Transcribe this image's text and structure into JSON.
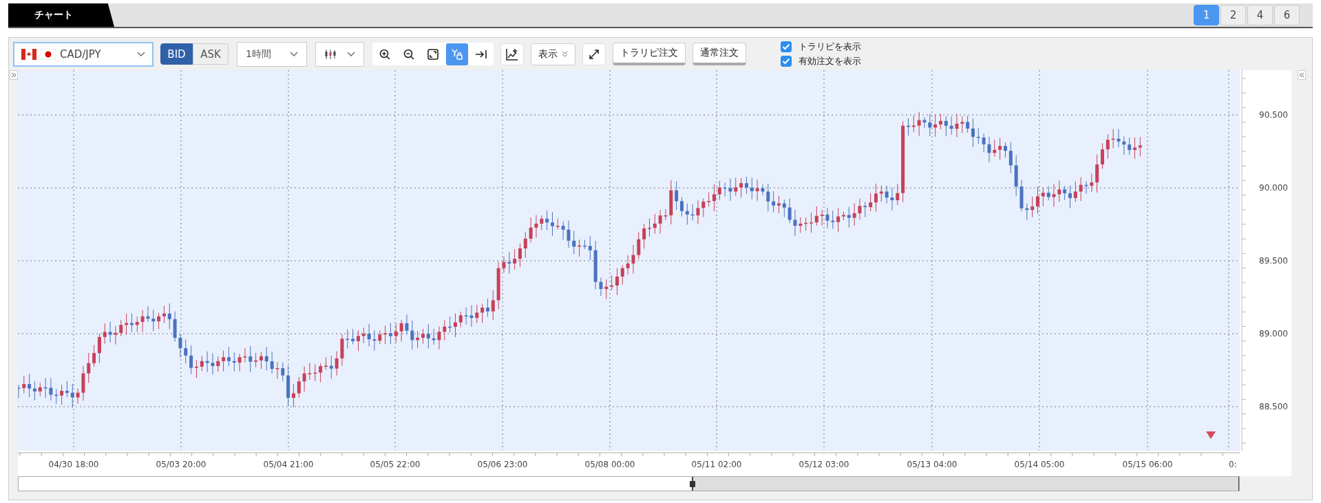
{
  "main_tab": {
    "label": "チャート"
  },
  "layout_tabs": [
    {
      "label": "1",
      "selected": true
    },
    {
      "label": "2",
      "selected": false
    },
    {
      "label": "4",
      "selected": false
    },
    {
      "label": "6",
      "selected": false
    }
  ],
  "toolbar": {
    "symbol_select": {
      "value": "CAD/JPY"
    },
    "price_side": [
      {
        "label": "BID",
        "selected": true
      },
      {
        "label": "ASK",
        "selected": false
      }
    ],
    "timeframe_select": {
      "value": "1時間"
    },
    "tools": [
      {
        "kind": "zoom-in",
        "selected": false
      },
      {
        "kind": "zoom-out",
        "selected": false
      },
      {
        "kind": "fit",
        "selected": false
      },
      {
        "kind": "y-lock",
        "selected": true
      },
      {
        "kind": "to-latest",
        "selected": false
      }
    ],
    "display_button": {
      "label": "表示"
    },
    "order_buttons": [
      {
        "label": "トラリピ注文"
      },
      {
        "label": "通常注文"
      }
    ],
    "checkboxes": [
      {
        "label": "トラリピを表示",
        "checked": true
      },
      {
        "label": "有効注文を表示",
        "checked": true
      }
    ]
  },
  "price_axis": {
    "labels": [
      "90.500",
      "90.000",
      "89.500",
      "89.000",
      "88.500"
    ]
  },
  "time_axis": {
    "labels": [
      "04/30 18:00",
      "05/03 20:00",
      "05/04 21:00",
      "05/05 22:00",
      "05/06 23:00",
      "05/08 00:00",
      "05/11 02:00",
      "05/12 03:00",
      "05/13 04:00",
      "05/14 05:00",
      "05/15 06:00",
      "0:"
    ]
  }
}
